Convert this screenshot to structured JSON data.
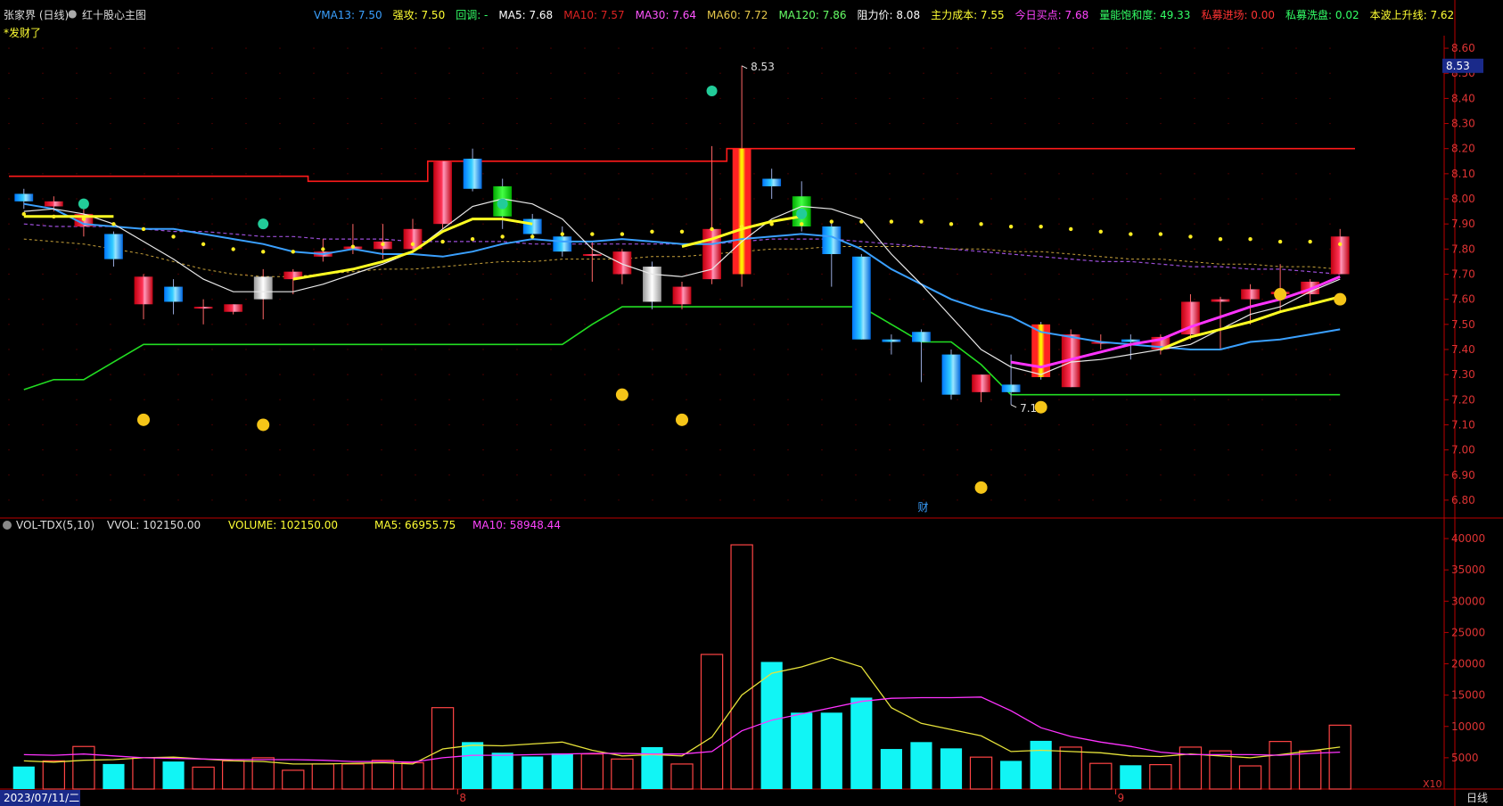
{
  "header": {
    "stock_name": "张家界 (日线)",
    "indicator_name": "红十股心主图",
    "signal_note": "*发财了",
    "stats": [
      {
        "label": "VMA13:",
        "value": "7.50",
        "color": "#3aa0ff"
      },
      {
        "label": "强攻:",
        "value": "7.50",
        "color": "#ffff33"
      },
      {
        "label": "回调:",
        "value": "-",
        "color": "#33ff66"
      },
      {
        "label": "MA5:",
        "value": "7.68",
        "color": "#ffffff"
      },
      {
        "label": "MA10:",
        "value": "7.57",
        "color": "#d22"
      },
      {
        "label": "MA30:",
        "value": "7.64",
        "color": "#ff55ff"
      },
      {
        "label": "MA60:",
        "value": "7.72",
        "color": "#e6c84a"
      },
      {
        "label": "MA120:",
        "value": "7.86",
        "color": "#66ff66"
      },
      {
        "label": "阻力价:",
        "value": "8.08",
        "color": "#ffffff"
      },
      {
        "label": "主力成本:",
        "value": "7.55",
        "color": "#ffff33"
      },
      {
        "label": "今日买点:",
        "value": "7.68",
        "color": "#ff44ff"
      },
      {
        "label": "量能饱和度:",
        "value": "49.33",
        "color": "#33ff66"
      },
      {
        "label": "私募进场:",
        "value": "0.00",
        "color": "#ff3333"
      },
      {
        "label": "私募洗盘:",
        "value": "0.02",
        "color": "#33ff66"
      },
      {
        "label": "本波上升线:",
        "value": "7.62",
        "color": "#ffff33"
      }
    ]
  },
  "price_axis": {
    "ticks": [
      "8.60",
      "8.50",
      "8.40",
      "8.30",
      "8.20",
      "8.10",
      "8.00",
      "7.90",
      "7.80",
      "7.70",
      "7.60",
      "7.50",
      "7.40",
      "7.30",
      "7.20",
      "7.10",
      "7.00",
      "6.90",
      "6.80"
    ],
    "current": "8.53"
  },
  "volume_header": {
    "name": "VOL-TDX(5,10)",
    "vvol": "VVOL: 102150.00",
    "volume": "VOLUME: 102150.00",
    "ma5": "MA5: 66955.75",
    "ma10": "MA10: 58948.44"
  },
  "volume_axis": {
    "ticks": [
      "40000",
      "35000",
      "30000",
      "25000",
      "20000",
      "15000",
      "10000",
      "5000"
    ],
    "unit": "X10"
  },
  "footer": {
    "date": "2023/07/11/二",
    "period": "日线",
    "month_marks": [
      "8",
      "9"
    ],
    "cai_mark": "财"
  },
  "annotations": {
    "high": "8.53",
    "low": "7.18"
  },
  "chart_data": {
    "type": "candlestick",
    "ylim": [
      6.75,
      8.65
    ],
    "vol_ylim": [
      0,
      42000
    ],
    "candles": [
      {
        "o": 8.02,
        "h": 8.04,
        "l": 7.96,
        "c": 7.99,
        "v": 3600
      },
      {
        "o": 7.97,
        "h": 8.01,
        "l": 7.95,
        "c": 7.99,
        "v": 4500
      },
      {
        "o": 7.89,
        "h": 7.96,
        "l": 7.85,
        "c": 7.94,
        "v": 6800
      },
      {
        "o": 7.86,
        "h": 7.87,
        "l": 7.73,
        "c": 7.76,
        "v": 4000
      },
      {
        "o": 7.58,
        "h": 7.7,
        "l": 7.52,
        "c": 7.69,
        "v": 5000
      },
      {
        "o": 7.65,
        "h": 7.68,
        "l": 7.54,
        "c": 7.59,
        "v": 4400
      },
      {
        "o": 7.57,
        "h": 7.6,
        "l": 7.5,
        "c": 7.57,
        "v": 3500
      },
      {
        "o": 7.55,
        "h": 7.58,
        "l": 7.54,
        "c": 7.58,
        "v": 4500
      },
      {
        "o": 7.6,
        "h": 7.72,
        "l": 7.52,
        "c": 7.69,
        "v": 5000
      },
      {
        "o": 7.68,
        "h": 7.72,
        "l": 7.62,
        "c": 7.71,
        "v": 3000
      },
      {
        "o": 7.77,
        "h": 7.84,
        "l": 7.75,
        "c": 7.79,
        "v": 4000
      },
      {
        "o": 7.8,
        "h": 7.9,
        "l": 7.78,
        "c": 7.81,
        "v": 4000
      },
      {
        "o": 7.8,
        "h": 7.9,
        "l": 7.76,
        "c": 7.83,
        "v": 4600
      },
      {
        "o": 7.8,
        "h": 7.92,
        "l": 7.78,
        "c": 7.88,
        "v": 4200
      },
      {
        "o": 7.9,
        "h": 8.15,
        "l": 7.88,
        "c": 8.15,
        "v": 13000
      },
      {
        "o": 8.16,
        "h": 8.2,
        "l": 8.03,
        "c": 8.04,
        "v": 7500
      },
      {
        "o": 8.05,
        "h": 8.08,
        "l": 7.88,
        "c": 7.93,
        "v": 5800
      },
      {
        "o": 7.92,
        "h": 7.94,
        "l": 7.84,
        "c": 7.86,
        "v": 5200
      },
      {
        "o": 7.85,
        "h": 7.89,
        "l": 7.77,
        "c": 7.79,
        "v": 5700
      },
      {
        "o": 7.78,
        "h": 7.83,
        "l": 7.67,
        "c": 7.78,
        "v": 5600
      },
      {
        "o": 7.7,
        "h": 7.8,
        "l": 7.66,
        "c": 7.79,
        "v": 4800
      },
      {
        "o": 7.73,
        "h": 7.75,
        "l": 7.56,
        "c": 7.59,
        "v": 6700
      },
      {
        "o": 7.58,
        "h": 7.67,
        "l": 7.56,
        "c": 7.65,
        "v": 4000
      },
      {
        "o": 7.68,
        "h": 8.21,
        "l": 7.66,
        "c": 7.88,
        "v": 21500
      },
      {
        "o": 7.7,
        "h": 8.53,
        "l": 7.65,
        "c": 8.2,
        "v": 39000
      },
      {
        "o": 8.08,
        "h": 8.12,
        "l": 8.0,
        "c": 8.05,
        "v": 20300
      },
      {
        "o": 8.01,
        "h": 8.07,
        "l": 7.87,
        "c": 7.89,
        "v": 12200
      },
      {
        "o": 7.89,
        "h": 7.91,
        "l": 7.65,
        "c": 7.78,
        "v": 12200
      },
      {
        "o": 7.77,
        "h": 7.78,
        "l": 7.44,
        "c": 7.44,
        "v": 14600
      },
      {
        "o": 7.44,
        "h": 7.46,
        "l": 7.38,
        "c": 7.43,
        "v": 6400
      },
      {
        "o": 7.47,
        "h": 7.48,
        "l": 7.27,
        "c": 7.43,
        "v": 7500
      },
      {
        "o": 7.38,
        "h": 7.4,
        "l": 7.2,
        "c": 7.22,
        "v": 6500
      },
      {
        "o": 7.23,
        "h": 7.3,
        "l": 7.19,
        "c": 7.3,
        "v": 5100
      },
      {
        "o": 7.26,
        "h": 7.38,
        "l": 7.18,
        "c": 7.23,
        "v": 4500
      },
      {
        "o": 7.5,
        "h": 7.51,
        "l": 7.28,
        "c": 7.29,
        "v": 7700
      },
      {
        "o": 7.25,
        "h": 7.48,
        "l": 7.25,
        "c": 7.46,
        "v": 6700
      },
      {
        "o": 7.43,
        "h": 7.46,
        "l": 7.4,
        "c": 7.43,
        "v": 4100
      },
      {
        "o": 7.44,
        "h": 7.46,
        "l": 7.36,
        "c": 7.43,
        "v": 3800
      },
      {
        "o": 7.4,
        "h": 7.46,
        "l": 7.38,
        "c": 7.45,
        "v": 3900
      },
      {
        "o": 7.46,
        "h": 7.62,
        "l": 7.44,
        "c": 7.59,
        "v": 6700
      },
      {
        "o": 7.59,
        "h": 7.61,
        "l": 7.4,
        "c": 7.6,
        "v": 6100
      },
      {
        "o": 7.6,
        "h": 7.66,
        "l": 7.5,
        "c": 7.64,
        "v": 3700
      },
      {
        "o": 7.62,
        "h": 7.74,
        "l": 7.55,
        "c": 7.63,
        "v": 7600
      },
      {
        "o": 7.62,
        "h": 7.68,
        "l": 7.58,
        "c": 7.67,
        "v": 6100
      },
      {
        "o": 7.7,
        "h": 7.88,
        "l": 7.7,
        "c": 7.85,
        "v": 10200
      }
    ],
    "lines": {
      "resistance": [
        8.09,
        8.09,
        8.09,
        8.09,
        8.09,
        8.09,
        8.09,
        8.09,
        8.09,
        8.09,
        8.07,
        8.07,
        8.07,
        8.07,
        8.15,
        8.15,
        8.15,
        8.15,
        8.15,
        8.15,
        8.15,
        8.15,
        8.15,
        8.15,
        8.2,
        8.2,
        8.2,
        8.2,
        8.2,
        8.2,
        8.2,
        8.2,
        8.2,
        8.2,
        8.2,
        8.2,
        8.2,
        8.2,
        8.2,
        8.2,
        8.2,
        8.2,
        8.2,
        8.2,
        8.2
      ],
      "support": [
        7.24,
        7.28,
        7.28,
        7.35,
        7.42,
        7.42,
        7.42,
        7.42,
        7.42,
        7.42,
        7.42,
        7.42,
        7.42,
        7.42,
        7.42,
        7.42,
        7.42,
        7.42,
        7.42,
        7.5,
        7.57,
        7.57,
        7.57,
        7.57,
        7.57,
        7.57,
        7.57,
        7.57,
        7.57,
        7.5,
        7.43,
        7.43,
        7.34,
        7.22,
        7.22,
        7.22,
        7.22,
        7.22,
        7.22,
        7.22,
        7.22,
        7.22,
        7.22,
        7.22,
        7.22
      ],
      "blue_ma": [
        7.98,
        7.96,
        7.9,
        7.89,
        7.88,
        7.88,
        7.86,
        7.84,
        7.82,
        7.79,
        7.78,
        7.8,
        7.78,
        7.78,
        7.77,
        7.79,
        7.82,
        7.84,
        7.83,
        7.83,
        7.84,
        7.83,
        7.82,
        7.82,
        7.84,
        7.85,
        7.86,
        7.85,
        7.8,
        7.72,
        7.66,
        7.6,
        7.56,
        7.53,
        7.47,
        7.45,
        7.43,
        7.42,
        7.41,
        7.4,
        7.4,
        7.43,
        7.44,
        7.46,
        7.48
      ],
      "white_ma": [
        7.95,
        7.96,
        7.94,
        7.9,
        7.83,
        7.76,
        7.68,
        7.63,
        7.63,
        7.63,
        7.66,
        7.7,
        7.74,
        7.79,
        7.88,
        7.97,
        8.0,
        7.98,
        7.92,
        7.8,
        7.74,
        7.7,
        7.69,
        7.72,
        7.83,
        7.92,
        7.97,
        7.96,
        7.92,
        7.78,
        7.66,
        7.53,
        7.4,
        7.33,
        7.3,
        7.35,
        7.36,
        7.38,
        7.4,
        7.42,
        7.48,
        7.54,
        7.57,
        7.63,
        7.68
      ],
      "yellow_ma": [
        7.93,
        7.93,
        7.93,
        7.93,
        null,
        null,
        null,
        null,
        null,
        7.68,
        7.7,
        7.72,
        7.75,
        7.79,
        7.87,
        7.92,
        7.92,
        7.9,
        null,
        null,
        null,
        null,
        7.81,
        7.84,
        7.88,
        7.91,
        7.93,
        null,
        null,
        null,
        null,
        null,
        null,
        null,
        null,
        null,
        null,
        null,
        7.4,
        7.45,
        7.48,
        7.51,
        7.55,
        7.58,
        7.61
      ],
      "magenta_ma": [
        null,
        null,
        null,
        null,
        null,
        null,
        null,
        null,
        null,
        null,
        null,
        null,
        null,
        null,
        null,
        null,
        null,
        null,
        null,
        null,
        null,
        null,
        null,
        null,
        null,
        null,
        null,
        null,
        null,
        null,
        null,
        null,
        null,
        7.35,
        7.33,
        7.36,
        7.39,
        7.42,
        7.44,
        7.49,
        7.53,
        7.57,
        7.6,
        7.64,
        7.69
      ],
      "purple_dash": [
        7.9,
        7.89,
        7.89,
        7.89,
        7.88,
        7.87,
        7.87,
        7.86,
        7.85,
        7.85,
        7.84,
        7.84,
        7.84,
        7.83,
        7.83,
        7.83,
        7.83,
        7.82,
        7.82,
        7.82,
        7.82,
        7.82,
        7.82,
        7.82,
        7.83,
        7.84,
        7.84,
        7.84,
        7.83,
        7.82,
        7.81,
        7.8,
        7.79,
        7.78,
        7.77,
        7.76,
        7.75,
        7.75,
        7.74,
        7.73,
        7.73,
        7.72,
        7.72,
        7.71,
        7.7
      ],
      "yellow_dash": [
        7.84,
        7.83,
        7.82,
        7.8,
        7.78,
        7.75,
        7.72,
        7.7,
        7.69,
        7.69,
        7.7,
        7.71,
        7.72,
        7.72,
        7.73,
        7.74,
        7.75,
        7.75,
        7.76,
        7.76,
        7.76,
        7.77,
        7.77,
        7.78,
        7.79,
        7.8,
        7.8,
        7.81,
        7.81,
        7.81,
        7.81,
        7.8,
        7.8,
        7.79,
        7.79,
        7.78,
        7.77,
        7.76,
        7.76,
        7.75,
        7.74,
        7.74,
        7.73,
        7.73,
        7.72
      ],
      "vol_ma5": [
        4500,
        4300,
        4600,
        4700,
        5000,
        5100,
        4800,
        4500,
        4400,
        4000,
        4000,
        4100,
        4200,
        4000,
        6400,
        7000,
        6900,
        7200,
        7500,
        6200,
        5300,
        5500,
        5300,
        8300,
        15000,
        18500,
        19500,
        21000,
        19500,
        13000,
        10500,
        9500,
        8500,
        6000,
        6200,
        6000,
        5800,
        5300,
        5200,
        5600,
        5300,
        5000,
        5500,
        6100,
        6700
      ],
      "vol_ma10": [
        5500,
        5400,
        5600,
        5300,
        5000,
        4900,
        4800,
        4700,
        4700,
        4700,
        4600,
        4400,
        4400,
        4300,
        5000,
        5400,
        5400,
        5500,
        5600,
        5700,
        5700,
        5600,
        5600,
        6000,
        9300,
        11000,
        12000,
        13000,
        14000,
        14500,
        14600,
        14600,
        14700,
        12500,
        9800,
        8400,
        7500,
        6800,
        5900,
        5500,
        5500,
        5500,
        5400,
        5700,
        5900
      ]
    }
  }
}
